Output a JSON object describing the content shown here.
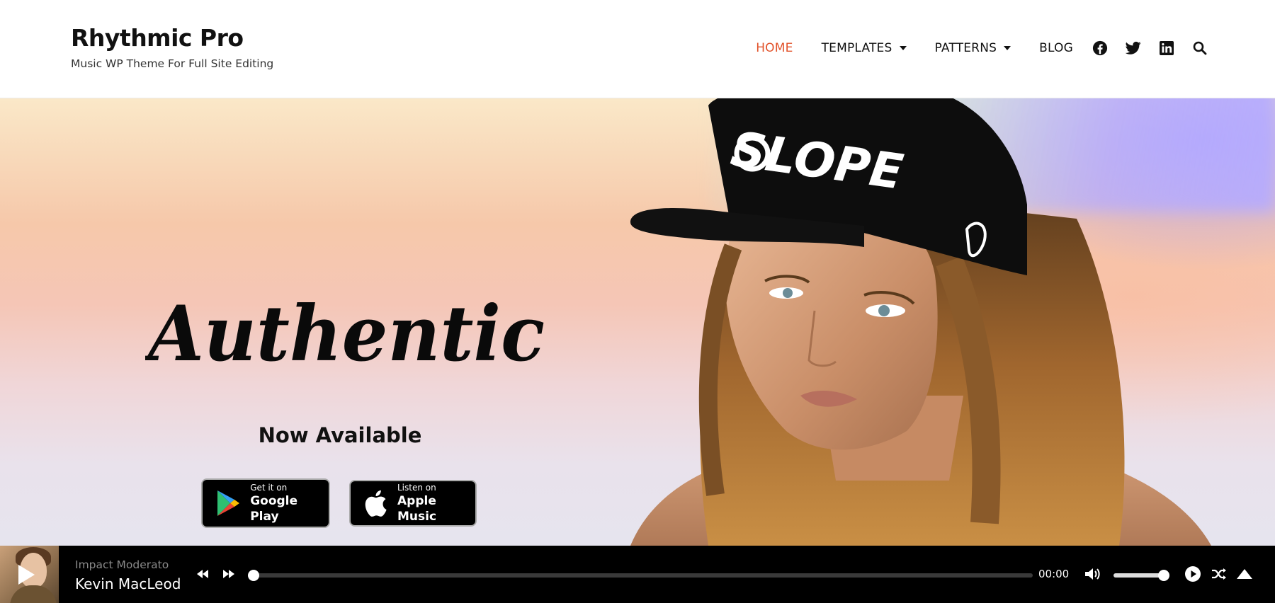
{
  "site": {
    "title": "Rhythmic Pro",
    "tagline": "Music WP Theme For Full Site Editing"
  },
  "nav": {
    "items": [
      {
        "label": "HOME",
        "active": true,
        "dropdown": false
      },
      {
        "label": "TEMPLATES",
        "active": false,
        "dropdown": true
      },
      {
        "label": "PATTERNS",
        "active": false,
        "dropdown": true
      },
      {
        "label": "BLOG",
        "active": false,
        "dropdown": false
      }
    ],
    "icons": [
      "facebook-icon",
      "twitter-icon",
      "linkedin-icon",
      "search-icon"
    ],
    "active_color": "#e2532b"
  },
  "hero": {
    "title": "Authentic",
    "subtitle": "Now Available",
    "cap_text": "SLOPE",
    "buttons": [
      {
        "small": "Get it on",
        "big": "Google Play",
        "icon": "google-play-icon"
      },
      {
        "small": "Listen on",
        "big": "Apple Music",
        "icon": "apple-icon"
      }
    ]
  },
  "player": {
    "artist": "Impact Moderato",
    "title": "Kevin MacLeod",
    "time": "00:00",
    "progress": 0,
    "volume": 0.9,
    "controls": [
      "rewind-icon",
      "fast-forward-icon",
      "volume-icon",
      "play-icon",
      "shuffle-icon",
      "expand-icon"
    ]
  }
}
